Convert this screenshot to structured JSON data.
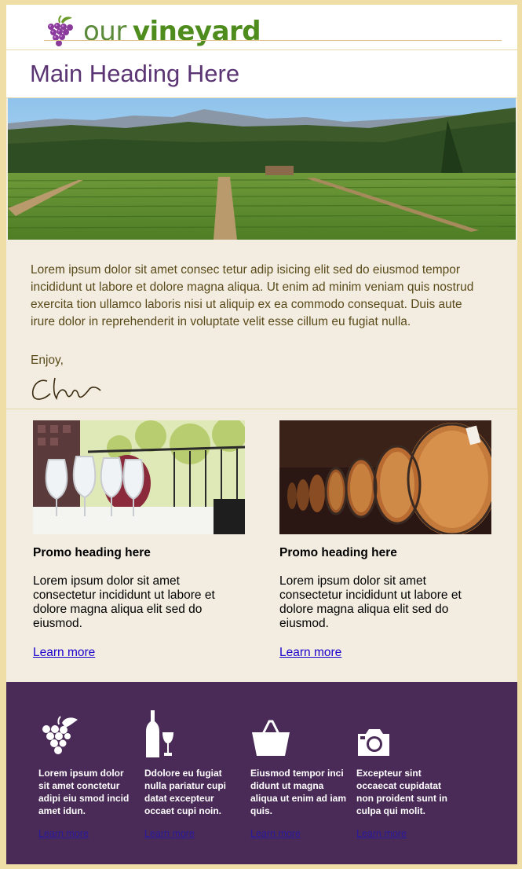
{
  "logo": {
    "word1": "our",
    "word2": "vineyard",
    "icon": "grapes-icon"
  },
  "main_heading": "Main Heading Here",
  "intro": {
    "body": "Lorem ipsum dolor sit amet consec tetur adip isicing elit sed do eiusmod tempor incididunt ut labore et dolore magna aliqua. Ut enim ad minim veniam quis nostrud exercita tion ullamco laboris nisi ut aliquip ex ea commodo consequat. Duis aute irure dolor in reprehenderit in voluptate velit esse cillum eu fugiat nulla.",
    "signoff": "Enjoy,"
  },
  "promos": [
    {
      "heading": "Promo heading here",
      "body": "Lorem ipsum dolor sit amet consectetur incididunt ut labore et dolore magna aliqua elit sed do eiusmod.",
      "link": "Learn more",
      "image": "wine-glasses-photo"
    },
    {
      "heading": "Promo heading here",
      "body": "Lorem ipsum dolor sit amet consectetur incididunt ut labore et dolore magna aliqua elit sed do eiusmod.",
      "link": "Learn more",
      "image": "wine-barrels-photo"
    }
  ],
  "footer": {
    "items": [
      {
        "icon": "grapes-icon",
        "text": "Lorem ipsum dolor sit amet conctetur adipi eiu smod incid amet idun.",
        "link": "Learn more"
      },
      {
        "icon": "wine-bottle-glass-icon",
        "text": "Ddolore eu fugiat nulla pariatur cupi datat excepteur occaet cupi noin.",
        "link": "Learn more"
      },
      {
        "icon": "basket-icon",
        "text": "Eiusmod tempor inci didunt ut magna aliqua ut enim ad iam quis.",
        "link": "Learn more"
      },
      {
        "icon": "camera-icon",
        "text": "Excepteur sint occaecat cupidatat non proident sunt in culpa qui molit.",
        "link": "Learn more"
      }
    ]
  },
  "colors": {
    "accent_purple": "#5b3474",
    "footer_bg": "#4a2a57",
    "border_gold": "#efdfa6",
    "link_blue": "#1a00cc"
  }
}
